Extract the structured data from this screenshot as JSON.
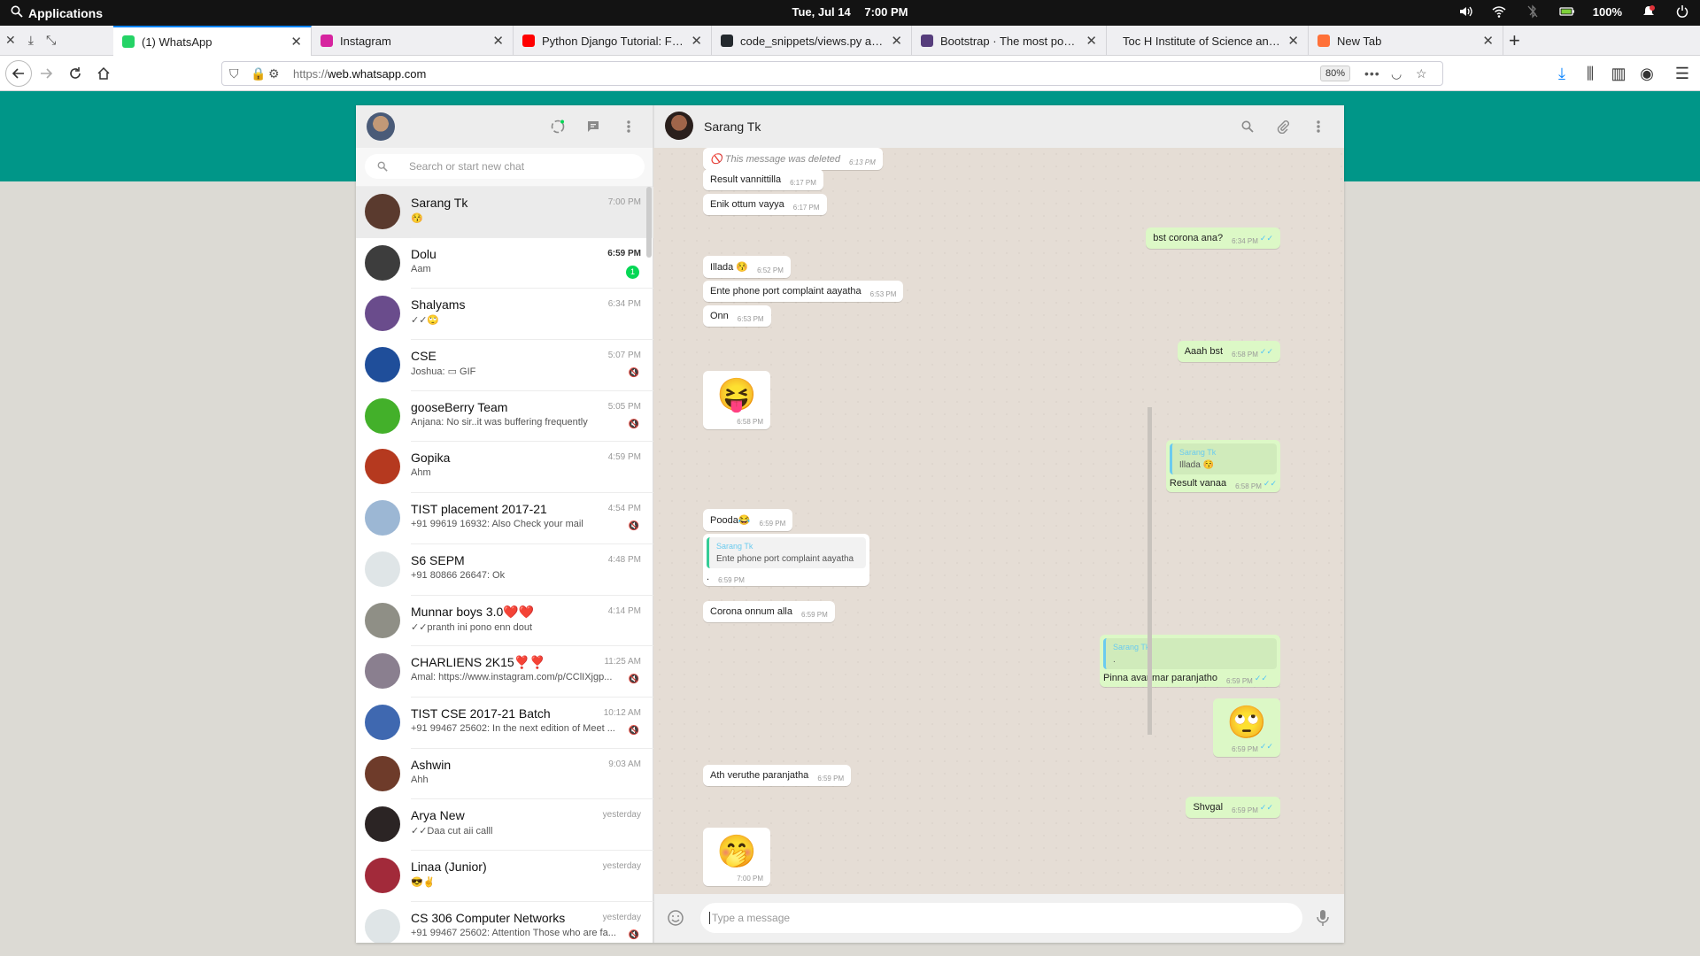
{
  "os": {
    "apps_label": "Applications",
    "date": "Tue, Jul 14",
    "time": "7:00 PM",
    "battery": "100%"
  },
  "browser": {
    "tabs": [
      {
        "title": "(1) WhatsApp",
        "favicon_color": "#25d366",
        "active": true
      },
      {
        "title": "Instagram",
        "favicon_color": "#d6249f"
      },
      {
        "title": "Python Django Tutorial: Full-F",
        "favicon_color": "#ff0000"
      },
      {
        "title": "code_snippets/views.py at ma",
        "favicon_color": "#24292e"
      },
      {
        "title": "Bootstrap · The most popular",
        "favicon_color": "#563d7c"
      },
      {
        "title": "Toc H Institute of Science and Te",
        "favicon_color": ""
      },
      {
        "title": "New Tab",
        "favicon_color": "#ff7139"
      }
    ],
    "url": "https://web.whatsapp.com",
    "url_prefix": "https://",
    "url_host": "web.whatsapp.com",
    "zoom": "80%"
  },
  "sidebar": {
    "search_placeholder": "Search or start new chat",
    "chats": [
      {
        "name": "Sarang Tk",
        "time": "7:00 PM",
        "preview": "😚",
        "avatar": "#5a3a2e",
        "selected": true
      },
      {
        "name": "Dolu",
        "time": "6:59 PM",
        "preview": "Aam",
        "badge": "1",
        "avatar": "#3d3d3d",
        "bold_time": true
      },
      {
        "name": "Shalyams",
        "time": "6:34 PM",
        "preview": "✓✓🙄",
        "avatar": "#6a4c8c"
      },
      {
        "name": "CSE",
        "time": "5:07 PM",
        "preview": "Joshua: ▭ GIF",
        "avatar": "#1f4e9a",
        "muted": true
      },
      {
        "name": "gooseBerry Team",
        "time": "5:05 PM",
        "preview": "Anjana: No sir..it was buffering frequently",
        "avatar": "#43b02a",
        "muted": true
      },
      {
        "name": "Gopika",
        "time": "4:59 PM",
        "preview": "Ahm",
        "avatar": "#b5391f"
      },
      {
        "name": "TIST placement 2017-21",
        "time": "4:54 PM",
        "preview": "+91 99619 16932: Also Check your mail",
        "avatar": "#9cb7d4",
        "muted": true
      },
      {
        "name": "S6 SEPM",
        "time": "4:48 PM",
        "preview": "+91 80866 26647: Ok",
        "avatar": "#dfe5e7"
      },
      {
        "name": "Munnar boys 3.0❤️❤️",
        "time": "4:14 PM",
        "preview": "✓✓pranth ini pono enn dout",
        "avatar": "#8f8f86"
      },
      {
        "name": "CHARLIENS 2K15❣️❣️",
        "time": "11:25 AM",
        "preview": "Amal: https://www.instagram.com/p/CClIXjgp...",
        "avatar": "#8a7f8f",
        "muted": true
      },
      {
        "name": "TIST CSE 2017-21 Batch",
        "time": "10:12 AM",
        "preview": "+91 99467 25602: In the next edition of Meet ...",
        "avatar": "#3f68b0",
        "muted": true
      },
      {
        "name": "Ashwin",
        "time": "9:03 AM",
        "preview": "Ahh",
        "avatar": "#6e3b2a"
      },
      {
        "name": "Arya New",
        "time": "yesterday",
        "preview": "✓✓Daa cut aii calll",
        "avatar": "#2b2424"
      },
      {
        "name": "Linaa (Junior)",
        "time": "yesterday",
        "preview": "😎✌️",
        "avatar": "#a22a3a"
      },
      {
        "name": "CS 306 Computer Networks",
        "time": "yesterday",
        "preview": "+91 99467 25602: Attention Those who are fa...",
        "avatar": "#dfe5e7",
        "muted": true
      }
    ]
  },
  "conversation": {
    "contact": "Sarang Tk",
    "composer_placeholder": "Type a message",
    "messages": [
      {
        "text": "🚫 This message was deleted",
        "time": "6:13 PM"
      },
      {
        "text": "Result vannittilla",
        "time": "6:17 PM"
      },
      {
        "text": "Enik ottum vayya",
        "time": "6:17 PM"
      },
      {
        "text": "bst corona ana?",
        "time": "6:34 PM"
      },
      {
        "text": "Illada 😚",
        "time": "6:52 PM"
      },
      {
        "text": "Ente phone port complaint aayatha",
        "time": "6:53 PM"
      },
      {
        "text": "Onn",
        "time": "6:53 PM"
      },
      {
        "text": "Aaah bst",
        "time": "6:58 PM"
      },
      {
        "text": "😝",
        "time": "6:58 PM"
      },
      {
        "quote_name": "Sarang Tk",
        "quote_text": "Illada 😚",
        "text": "Result vanaa",
        "time": "6:58 PM"
      },
      {
        "text": "Pooda😂",
        "time": "6:59 PM"
      },
      {
        "quote_name": "Sarang Tk",
        "quote_text": "Ente phone port complaint aayatha",
        "text": ".",
        "time": "6:59 PM"
      },
      {
        "text": "Corona onnum alla",
        "time": "6:59 PM"
      },
      {
        "quote_name": "Sarang Tk",
        "quote_text": ".",
        "text": "Pinna avanmar paranjatho",
        "time": "6:59 PM"
      },
      {
        "text": "🙄",
        "time": "6:59 PM"
      },
      {
        "text": "Ath veruthe paranjatha",
        "time": "6:59 PM"
      },
      {
        "text": "Shvgal",
        "time": "6:59 PM"
      },
      {
        "text": "🤭",
        "time": "7:00 PM"
      }
    ]
  },
  "colors": {
    "teal": "#009688",
    "outgoing_bubble": "#dcf8c6",
    "incoming_bubble": "#ffffff",
    "unread_badge": "#06d755",
    "read_ticks": "#4fc3f7"
  }
}
